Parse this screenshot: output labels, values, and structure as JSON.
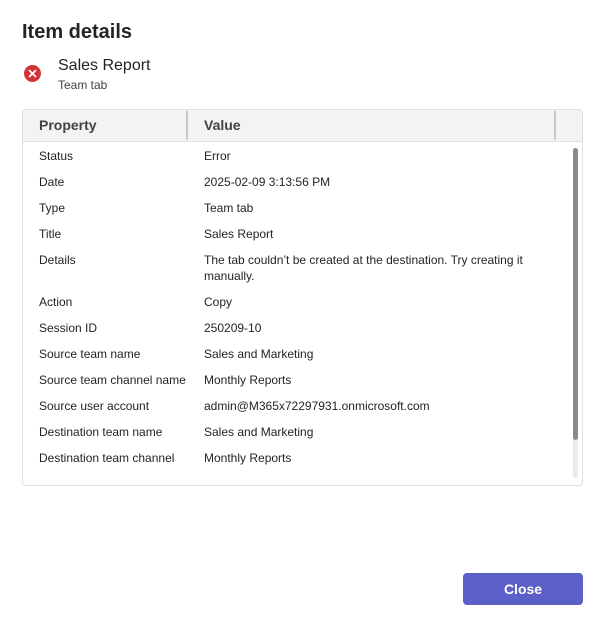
{
  "dialog": {
    "title": "Item details",
    "close_label": "Close"
  },
  "item": {
    "name": "Sales Report",
    "subtitle": "Team tab",
    "status_icon": "error-circle-icon",
    "status_color": "#d13438"
  },
  "table": {
    "columns": [
      "Property",
      "Value"
    ],
    "rows": [
      {
        "property": "Status",
        "value": "Error"
      },
      {
        "property": "Date",
        "value": "2025-02-09 3:13:56 PM"
      },
      {
        "property": "Type",
        "value": "Team tab"
      },
      {
        "property": "Title",
        "value": "Sales Report"
      },
      {
        "property": "Details",
        "value": "The tab couldn’t be created at the destination. Try creating it manually."
      },
      {
        "property": "Action",
        "value": "Copy"
      },
      {
        "property": "Session ID",
        "value": "250209-10"
      },
      {
        "property": "Source team name",
        "value": "Sales and Marketing"
      },
      {
        "property": "Source team channel name",
        "value": "Monthly Reports"
      },
      {
        "property": "Source user account",
        "value": "admin@M365x72297931.onmicrosoft.com"
      },
      {
        "property": "Destination team name",
        "value": "Sales and Marketing"
      },
      {
        "property": "Destination team channel",
        "value": "Monthly Reports"
      }
    ]
  },
  "colors": {
    "accent": "#5b5fc7",
    "error": "#d13438"
  }
}
